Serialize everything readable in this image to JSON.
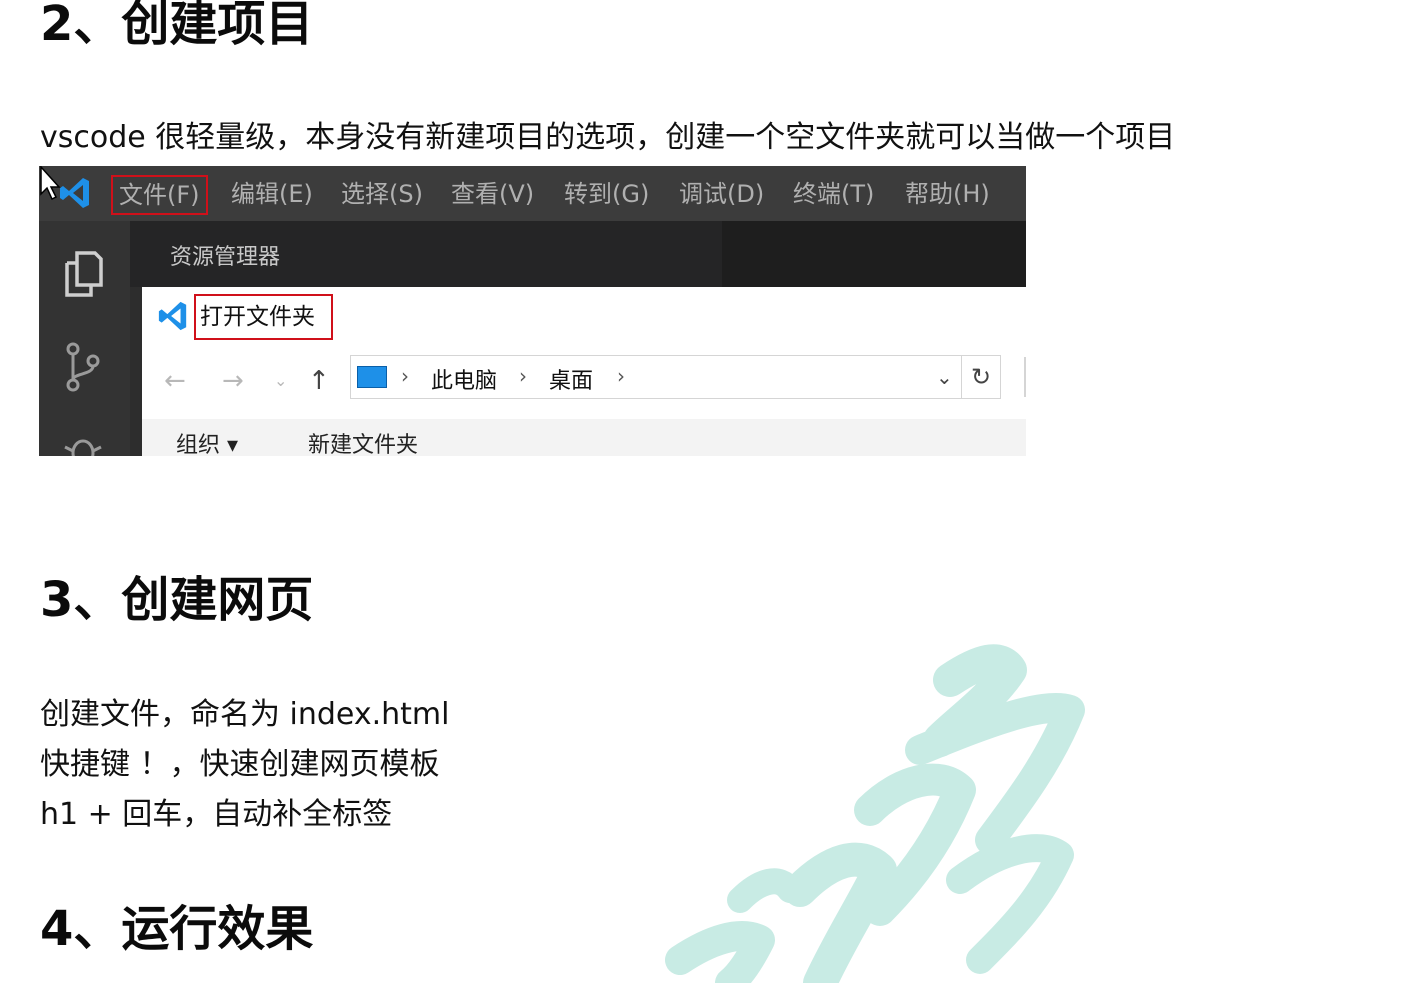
{
  "section2": {
    "heading": "2、创建项目",
    "intro": "vscode 很轻量级，本身没有新建项目的选项，创建一个空文件夹就可以当做一个项目"
  },
  "screenshot": {
    "menu": [
      "文件(F)",
      "编辑(E)",
      "选择(S)",
      "查看(V)",
      "转到(G)",
      "调试(D)",
      "终端(T)",
      "帮助(H)"
    ],
    "highlighted_menu": "文件(F)",
    "sidebar_title": "资源管理器",
    "dialog_title": "打开文件夹",
    "breadcrumb": [
      "此电脑",
      "桌面"
    ],
    "toolbar": {
      "organize": "组织 ▾",
      "new_folder": "新建文件夹"
    },
    "icons": [
      "cursor-icon",
      "vscode-logo-icon",
      "explorer-icon",
      "source-control-icon",
      "debug-icon",
      "back-arrow-icon",
      "forward-arrow-icon",
      "up-arrow-icon",
      "computer-icon",
      "dropdown-icon",
      "refresh-icon"
    ],
    "colors": {
      "highlight_border": "#d0101a",
      "titlebar": "#3c3c3c",
      "vscode_blue": "#1e90e8"
    }
  },
  "section3": {
    "heading": "3、创建网页",
    "lines": [
      "创建文件，命名为 index.html",
      "快捷键 ！，快速创建网页模板",
      "h1 + 回车，自动补全标签"
    ]
  },
  "section4": {
    "heading": "4、运行效果"
  },
  "watermark": {
    "color": "#a8dcd2"
  }
}
